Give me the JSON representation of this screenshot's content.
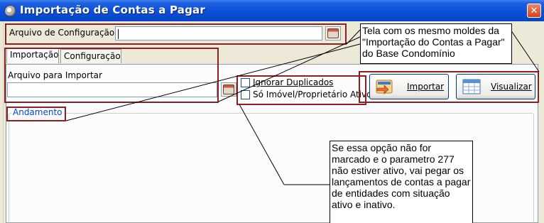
{
  "window": {
    "title": "Importação de Contas a Pagar",
    "close_symbol": "✕"
  },
  "config_row": {
    "label": "Arquivo de Configuração",
    "value": ""
  },
  "tabs": [
    {
      "label": "Importação",
      "active": true
    },
    {
      "label": "Configuração",
      "active": false
    }
  ],
  "import_tab": {
    "file_label": "Arquivo para Importar",
    "file_value": "",
    "ignore_duplicates": {
      "label": "Ignorar Duplicados",
      "checked": false
    },
    "only_active": {
      "label": "Só Imóvel/Proprietário Ativo",
      "checked": false
    },
    "import_button": "Importar",
    "view_button": "Visualizar"
  },
  "progress_group": {
    "title": "Andamento"
  },
  "annotations": {
    "top_note": "Tela com os mesmo moldes da \"Importação do Contas a Pagar\" do Base Condomínio",
    "bottom_note": "Se essa opção não for marcado e o parametro 277 não estiver ativo, vai pegar os lançamentos de contas a pagar  de entidades com situação  ativo e inativo."
  },
  "colors": {
    "annotation_border": "#8b2020",
    "title_bar": "#0a4fd6",
    "group_title": "#0046d5"
  },
  "icons": {
    "app": "app-logo-icon",
    "file": "folder-open-icon",
    "import": "import-icon",
    "view": "grid-view-icon"
  }
}
